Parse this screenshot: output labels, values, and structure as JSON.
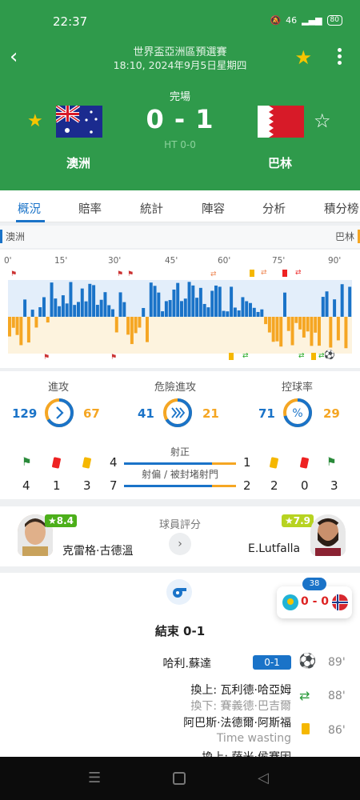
{
  "status_bar": {
    "time": "22:37",
    "network": "46",
    "battery": "80"
  },
  "header": {
    "competition": "世界盃亞洲區預選賽",
    "datetime": "18:10, 2024年9月5日星期四",
    "status": "完場",
    "score": "0 - 1",
    "halftime": "HT 0-0",
    "home": {
      "name": "澳洲"
    },
    "away": {
      "name": "巴林"
    },
    "colors": {
      "background": "#2f9a4b",
      "star": "#f6c500"
    }
  },
  "tabs": [
    "概況",
    "賠率",
    "統計",
    "陣容",
    "分析",
    "積分榜"
  ],
  "momentum": {
    "home_label": "澳洲",
    "away_label": "巴林",
    "ticks": [
      "0'",
      "15'",
      "30'",
      "45'",
      "60'",
      "75'",
      "90'"
    ],
    "colors": {
      "home": "#1a73c8",
      "away": "#f5a623"
    }
  },
  "stats": {
    "attacks": {
      "title": "進攻",
      "home": "129",
      "away": "67",
      "home_share": 0.66
    },
    "dangerous": {
      "title": "危險進攻",
      "home": "41",
      "away": "21",
      "home_share": 0.66
    },
    "possession": {
      "title": "控球率",
      "home": "71",
      "away": "29",
      "home_share": 0.71
    },
    "home_counts": {
      "corners": "4",
      "red": "1",
      "yellow": "3"
    },
    "away_counts": {
      "yellow": "2",
      "red": "0",
      "corners": "3"
    },
    "shots_on": {
      "label": "射正",
      "home": "4",
      "away": "1"
    },
    "shots_off": {
      "label": "射偏 / 被封堵射門",
      "home": "7",
      "away": "2"
    }
  },
  "ratings": {
    "title": "球員評分",
    "home_player": {
      "name": "克雷格·古德溫",
      "rating": "★8.4"
    },
    "away_player": {
      "name": "E.Lutfalla",
      "rating": "★7.9"
    }
  },
  "events": {
    "end_title": "結束 0-1",
    "items": [
      {
        "text": "哈利.蘇達",
        "score": "0-1",
        "minute": "89'"
      },
      {
        "in": "換上: 瓦利德·哈亞姆",
        "out": "換下: 賽義德·巴吉爾",
        "minute": "88'"
      },
      {
        "text": "阿巴斯·法德爾·阿斯福",
        "note": "Time wasting",
        "minute": "86'"
      },
      {
        "in": "換上: 薩米·侯賽因"
      }
    ]
  },
  "floating": {
    "badge": "38",
    "score": "0 - 0"
  }
}
